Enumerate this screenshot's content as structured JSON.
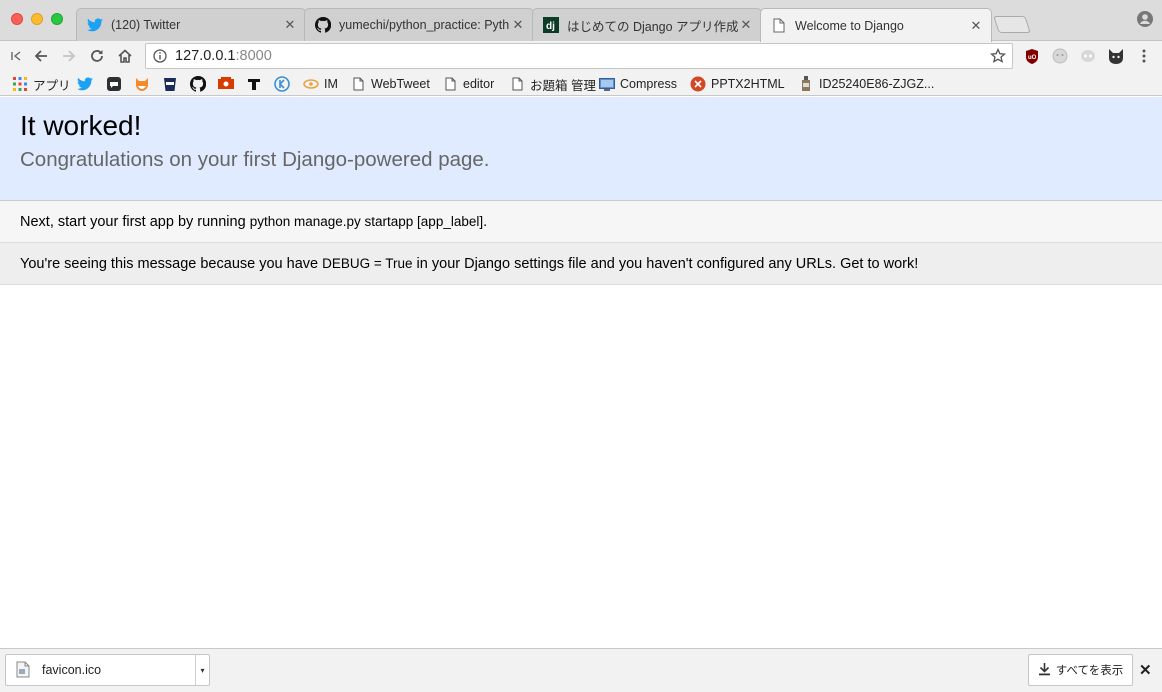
{
  "browser": {
    "tabs": [
      {
        "title": "(120) Twitter",
        "favicon": "twitter-bird-icon",
        "active": false
      },
      {
        "title": "yumechi/python_practice: Pyth",
        "favicon": "github-icon",
        "active": false
      },
      {
        "title": "はじめての Django アプリ作成、そ",
        "favicon": "django-icon",
        "active": false
      },
      {
        "title": "Welcome to Django",
        "favicon": "document-icon",
        "active": true
      }
    ],
    "close_glyph": "✕",
    "address": {
      "host": "127.0.0.1",
      "port": ":8000"
    },
    "bookmarks": [
      {
        "label": "アプリ",
        "icon": "apps-grid-icon"
      },
      {
        "label": "",
        "icon": "twitter-bird-icon"
      },
      {
        "label": "",
        "icon": "chat-bubble-icon"
      },
      {
        "label": "",
        "icon": "fox-icon"
      },
      {
        "label": "",
        "icon": "bucket-icon"
      },
      {
        "label": "",
        "icon": "github-icon"
      },
      {
        "label": "",
        "icon": "red-badge-icon"
      },
      {
        "label": "",
        "icon": "tool-icon"
      },
      {
        "label": "",
        "icon": "k-circle-icon"
      },
      {
        "label": "IM",
        "icon": "swirl-icon"
      },
      {
        "label": "WebTweet",
        "icon": "page-icon"
      },
      {
        "label": "editor",
        "icon": "page-icon"
      },
      {
        "label": "お題箱 管理",
        "icon": "page-icon"
      },
      {
        "label": "Compress",
        "icon": "monitor-icon"
      },
      {
        "label": "PPTX2HTML",
        "icon": "orange-circle-icon"
      },
      {
        "label": "ID25240E86-ZJGZ...",
        "icon": "bottle-icon"
      }
    ]
  },
  "page": {
    "heading": "It worked!",
    "subheading": "Congratulations on your first Django-powered page.",
    "instructions": {
      "before": "Next, start your first app by running ",
      "code": "python manage.py startapp [app_label]",
      "after": "."
    },
    "explanation": {
      "before": "You're seeing this message because you have ",
      "code": "DEBUG = True",
      "after": " in your Django settings file and you haven't configured any URLs. Get to work!"
    }
  },
  "downloads": {
    "file_name": "favicon.ico",
    "show_all_label": "すべてを表示",
    "dropdown_glyph": "▾"
  },
  "colors": {
    "summary_bg": "#e0ebff",
    "twitter_blue": "#1da1f2",
    "ublock_red": "#800000"
  }
}
